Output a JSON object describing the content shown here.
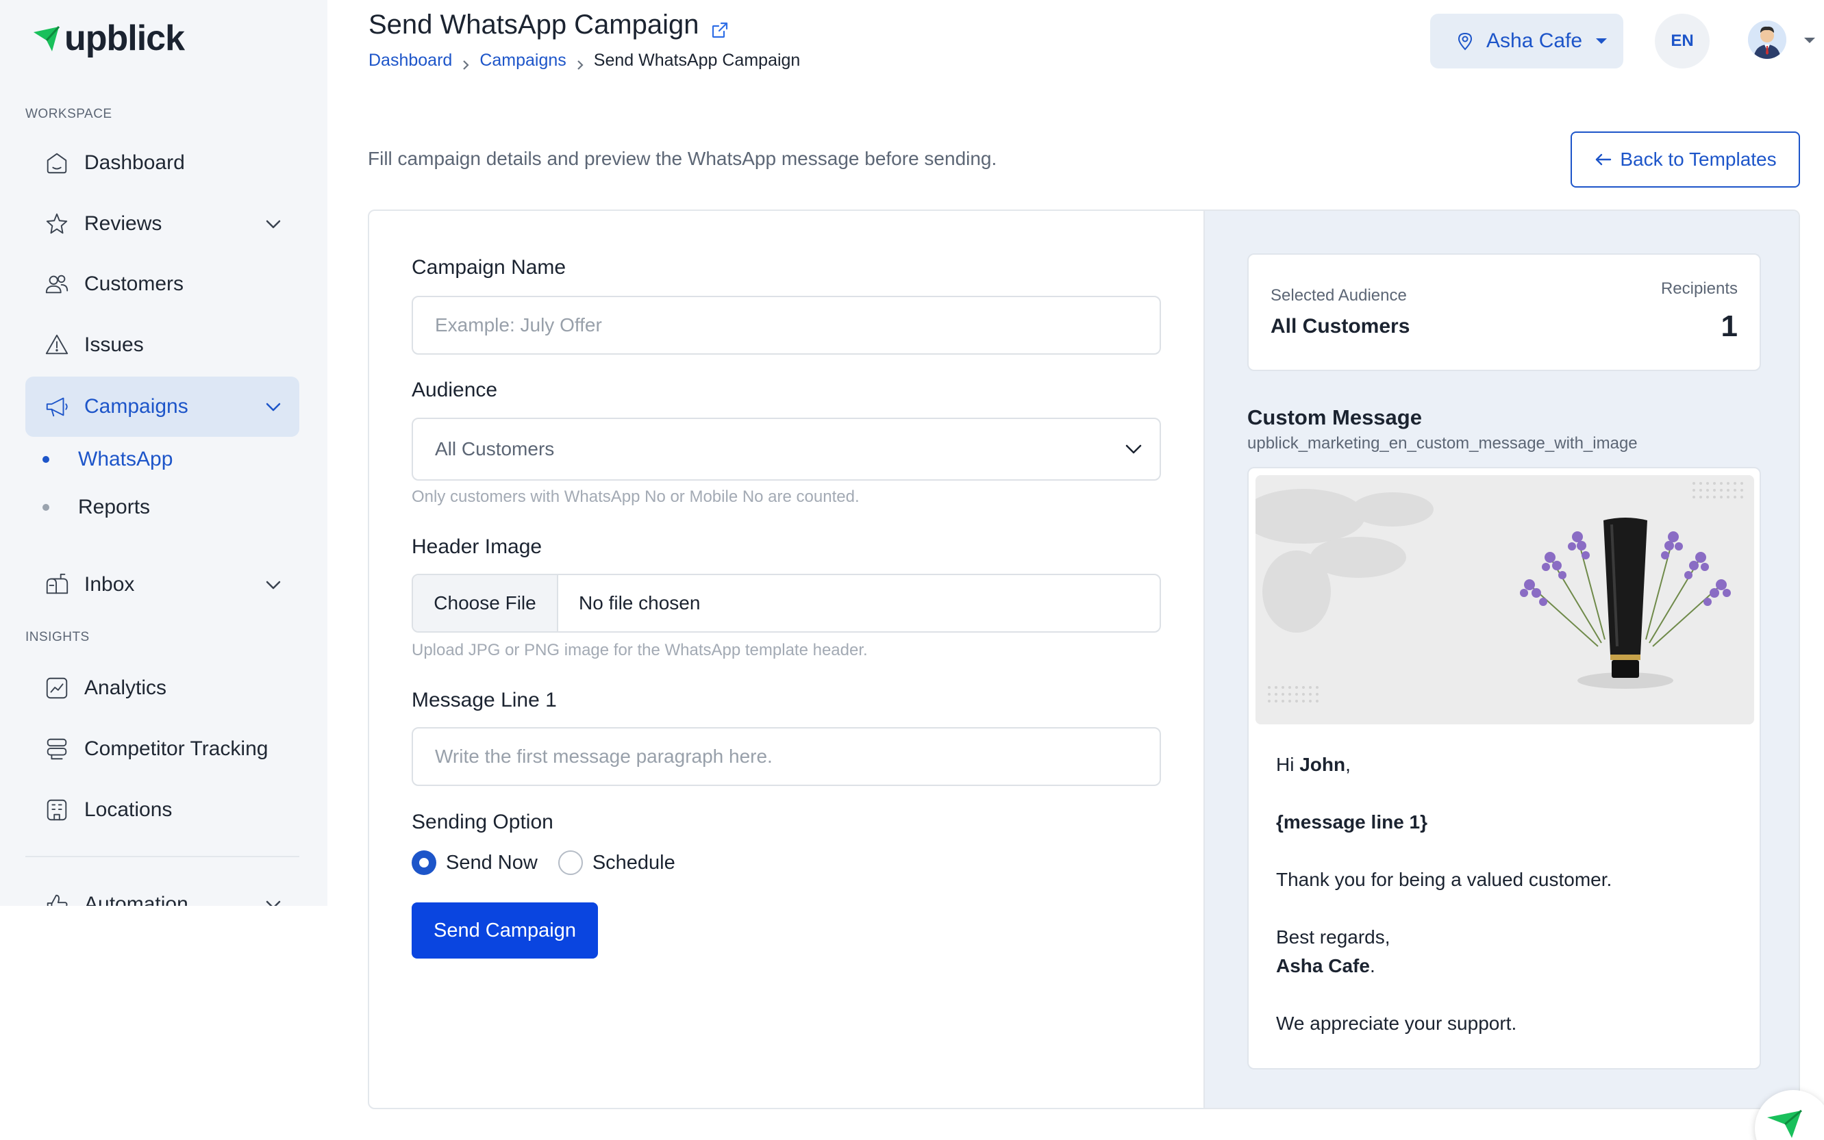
{
  "brand": {
    "name": "upblick",
    "accent": "#1d55c9",
    "green": "#19c05b"
  },
  "sidebar": {
    "workspace_label": "WORKSPACE",
    "insights_label": "INSIGHTS",
    "items": [
      {
        "label": "Dashboard"
      },
      {
        "label": "Reviews"
      },
      {
        "label": "Customers"
      },
      {
        "label": "Issues"
      },
      {
        "label": "Campaigns"
      },
      {
        "label": "Inbox"
      },
      {
        "label": "Analytics"
      },
      {
        "label": "Competitor Tracking"
      },
      {
        "label": "Locations"
      },
      {
        "label": "Automation"
      }
    ],
    "campaign_sub": [
      {
        "label": "WhatsApp"
      },
      {
        "label": "Reports"
      }
    ]
  },
  "header": {
    "title": "Send WhatsApp Campaign",
    "breadcrumb": [
      "Dashboard",
      "Campaigns",
      "Send WhatsApp Campaign"
    ],
    "location": "Asha Cafe",
    "language": "EN"
  },
  "page": {
    "subtitle": "Fill campaign details and preview the WhatsApp message before sending.",
    "back_button": "Back to Templates"
  },
  "form": {
    "campaign_name": {
      "label": "Campaign Name",
      "placeholder": "Example: July Offer"
    },
    "audience": {
      "label": "Audience",
      "value": "All Customers",
      "help": "Only customers with WhatsApp No or Mobile No are counted."
    },
    "header_image": {
      "label": "Header Image",
      "button": "Choose File",
      "status": "No file chosen",
      "help": "Upload JPG or PNG image for the WhatsApp template header."
    },
    "message_line_1": {
      "label": "Message Line 1",
      "placeholder": "Write the first message paragraph here."
    },
    "sending_option": {
      "label": "Sending Option",
      "options": [
        "Send Now",
        "Schedule"
      ],
      "selected": "Send Now"
    },
    "submit": "Send Campaign"
  },
  "preview": {
    "audience_label": "Selected Audience",
    "audience_value": "All Customers",
    "recipients_label": "Recipients",
    "recipients_value": "1",
    "template_title": "Custom Message",
    "template_id": "upblick_marketing_en_custom_message_with_image",
    "message": {
      "greeting_prefix": "Hi ",
      "name": "John",
      "greeting_suffix": ",",
      "line1": "{message line 1}",
      "thanks": "Thank you for being a valued customer.",
      "regards": "Best regards,",
      "business": "Asha Cafe",
      "business_suffix": ".",
      "closing": "We appreciate your support."
    }
  }
}
